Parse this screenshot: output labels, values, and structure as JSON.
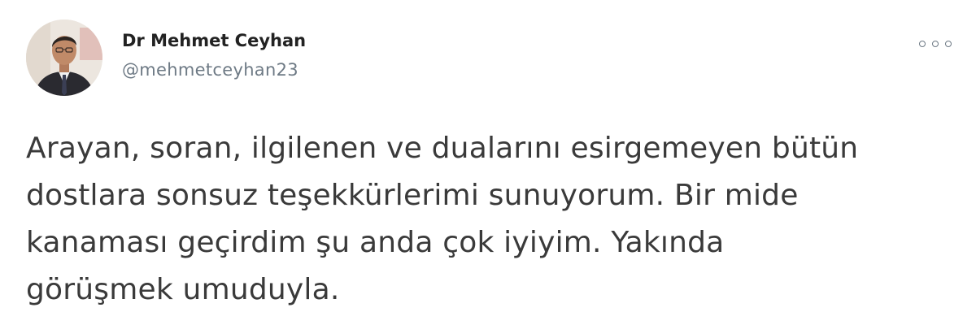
{
  "author": {
    "name": "Dr Mehmet Ceyhan",
    "handle": "@mehmetceyhan23",
    "avatar_icon": "profile-photo"
  },
  "menu": {
    "icon": "more-options-icon"
  },
  "tweet": {
    "lines": [
      "Arayan, soran, ilgilenen ve dualarını esirgemeyen bütün",
      "dostlara sonsuz teşekkürlerimi sunuyorum. Bir mide",
      "kanaması geçirdim şu anda çok iyiyim. Yakında",
      "görüşmek umuduyla."
    ]
  },
  "colors": {
    "name": "#222222",
    "handle": "#6e7a85",
    "text": "#3a3a3a",
    "background": "#ffffff"
  }
}
